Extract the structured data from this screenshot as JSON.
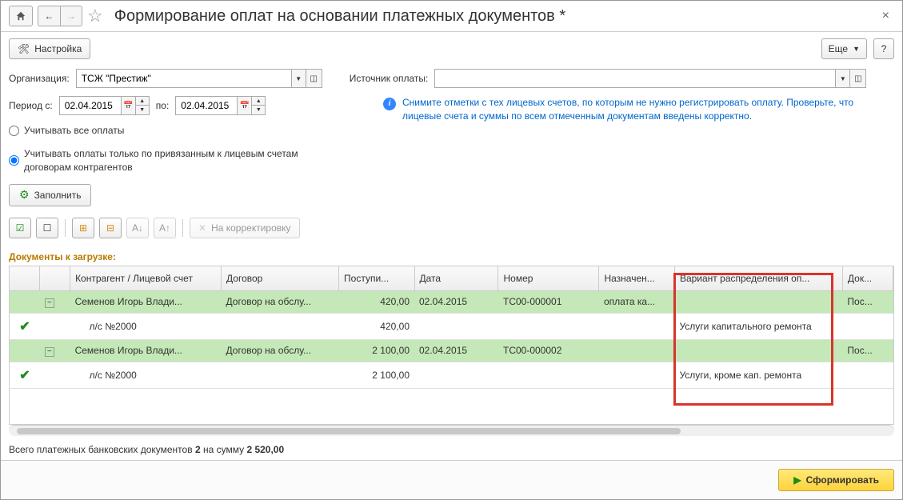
{
  "title": "Формирование оплат на основании платежных документов *",
  "toolbar": {
    "settings": "Настройка",
    "more": "Еще",
    "help": "?"
  },
  "fields": {
    "org_label": "Организация:",
    "org_value": "ТСЖ \"Престиж\"",
    "source_label": "Источник оплаты:",
    "source_value": "",
    "period_from_label": "Период с:",
    "period_from": "02.04.2015",
    "period_to_label": "по:",
    "period_to": "02.04.2015"
  },
  "radios": {
    "all": "Учитывать все оплаты",
    "linked": "Учитывать оплаты только по привязанным к лицевым счетам договорам контрагентов"
  },
  "info": "Снимите отметки с тех лицевых счетов, по которым не нужно регистрировать оплату. Проверьте, что лицевые счета и суммы по всем отмеченным документам введены корректно.",
  "fill_btn": "Заполнить",
  "correct_btn": "На корректировку",
  "section": "Документы к загрузке:",
  "cols": {
    "c1": "Контрагент / Лицевой счет",
    "c2": "Договор",
    "c3": "Поступи...",
    "c4": "Дата",
    "c5": "Номер",
    "c6": "Назначен...",
    "c7": "Вариант распределения оп...",
    "c8": "Док..."
  },
  "rows": [
    {
      "type": "parent",
      "c1": "Семенов Игорь Влади...",
      "c2": "Договор на обслу...",
      "c3": "420,00",
      "c4": "02.04.2015",
      "c5": "ТС00-000001",
      "c6": "оплата ка...",
      "c7": "",
      "c8": "Пос..."
    },
    {
      "type": "child",
      "checked": true,
      "c1": "л/с №2000",
      "c2": "",
      "c3": "420,00",
      "c4": "",
      "c5": "",
      "c6": "",
      "c7": "Услуги капитального ремонта",
      "c8": ""
    },
    {
      "type": "parent",
      "c1": "Семенов Игорь Влади...",
      "c2": "Договор на обслу...",
      "c3": "2 100,00",
      "c4": "02.04.2015",
      "c5": "ТС00-000002",
      "c6": "",
      "c7": "",
      "c8": "Пос..."
    },
    {
      "type": "child",
      "checked": true,
      "c1": "л/с №2000",
      "c2": "",
      "c3": "2 100,00",
      "c4": "",
      "c5": "",
      "c6": "",
      "c7": "Услуги, кроме кап. ремонта",
      "c8": ""
    }
  ],
  "footer": {
    "prefix": "Всего платежных банковских документов ",
    "count": "2",
    "mid": " на сумму ",
    "sum": "2 520,00"
  },
  "primary": "Сформировать"
}
